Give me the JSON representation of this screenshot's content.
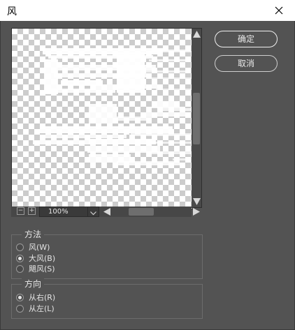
{
  "window": {
    "title": "风"
  },
  "preview": {
    "zoom": "100%"
  },
  "buttons": {
    "ok": "确定",
    "cancel": "取消"
  },
  "method_group": {
    "title": "方法",
    "options": [
      {
        "label": "风(W)",
        "checked": false
      },
      {
        "label": "大风(B)",
        "checked": true
      },
      {
        "label": "飓风(S)",
        "checked": false
      }
    ]
  },
  "direction_group": {
    "title": "方向",
    "options": [
      {
        "label": "从右(R)",
        "checked": true
      },
      {
        "label": "从左(L)",
        "checked": false
      }
    ]
  },
  "icons": {
    "close": "close-icon",
    "zoom_out": "zoom-out-icon",
    "zoom_in": "zoom-in-icon",
    "dropdown": "chevron-down-icon",
    "scroll_up": "arrow-up-icon",
    "scroll_down": "arrow-down-icon",
    "scroll_left": "arrow-left-icon",
    "scroll_right": "arrow-right-icon"
  },
  "colors": {
    "dialog_bg": "#535353",
    "titlebar_bg": "#ffffff",
    "text": "#e8e8e8"
  }
}
